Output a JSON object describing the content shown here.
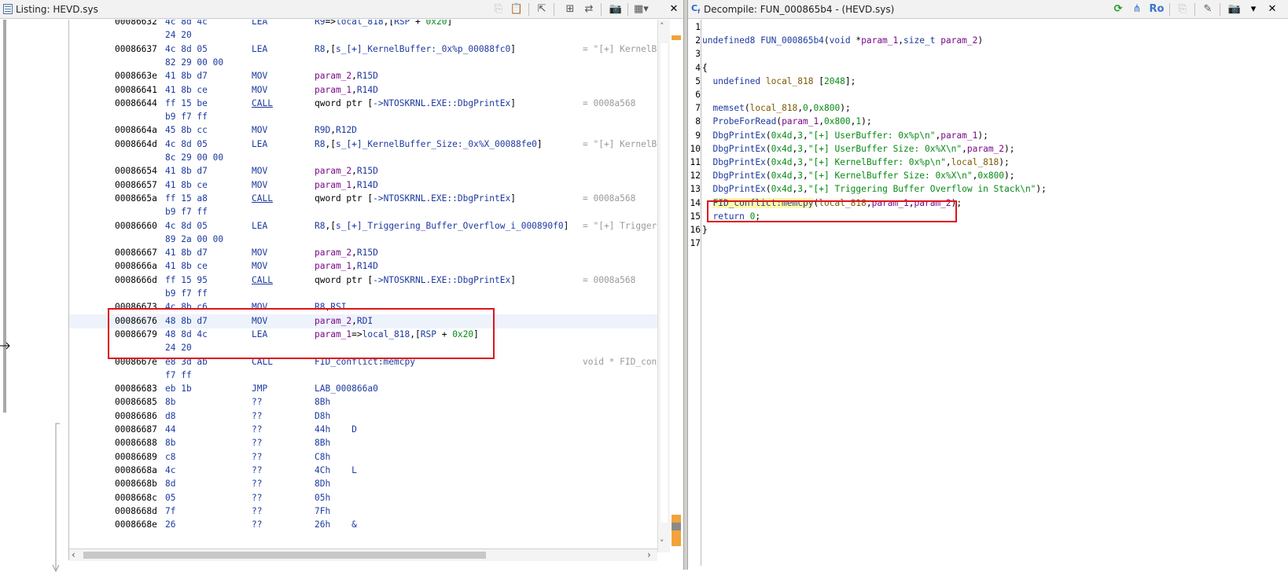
{
  "listing": {
    "title": "Listing:  HEVD.sys",
    "rows": [
      {
        "addr": "00086632",
        "bytes": "4c 8d 4c",
        "mn": "LEA",
        "op": [
          {
            "t": "R9",
            "c": "reg"
          },
          {
            "t": "=>"
          },
          {
            "t": "local_818",
            "c": "lbl"
          },
          {
            "t": ",["
          },
          {
            "t": "RSP",
            "c": "reg"
          },
          {
            "t": " + "
          },
          {
            "t": "0x20",
            "c": "num"
          },
          {
            "t": "]"
          }
        ],
        "cm": ""
      },
      {
        "addr": "",
        "bytes": "24 20",
        "mn": "",
        "op": [],
        "cm": ""
      },
      {
        "addr": "00086637",
        "bytes": "4c 8d 05",
        "mn": "LEA",
        "op": [
          {
            "t": "R8",
            "c": "reg"
          },
          {
            "t": ",["
          },
          {
            "t": "s_[+]_KernelBuffer:_0x%p_00088fc0",
            "c": "lbl"
          },
          {
            "t": "]"
          }
        ],
        "cm": "= \"[+] KernelB"
      },
      {
        "addr": "",
        "bytes": "82 29 00 00",
        "mn": "",
        "op": [],
        "cm": ""
      },
      {
        "addr": "0008663e",
        "bytes": "41 8b d7",
        "mn": "MOV",
        "op": [
          {
            "t": "param_2",
            "c": "par"
          },
          {
            "t": ","
          },
          {
            "t": "R15D",
            "c": "reg"
          }
        ],
        "cm": ""
      },
      {
        "addr": "00086641",
        "bytes": "41 8b ce",
        "mn": "MOV",
        "op": [
          {
            "t": "param_1",
            "c": "par"
          },
          {
            "t": ","
          },
          {
            "t": "R14D",
            "c": "reg"
          }
        ],
        "cm": ""
      },
      {
        "addr": "00086644",
        "bytes": "ff 15 be",
        "mn": "CALL",
        "u": true,
        "op": [
          {
            "t": "qword ptr ["
          },
          {
            "t": "->NTOSKRNL.EXE::DbgPrintEx",
            "c": "lbl"
          },
          {
            "t": "]"
          }
        ],
        "cm": "= 0008a568"
      },
      {
        "addr": "",
        "bytes": "b9 f7 ff",
        "mn": "",
        "op": [],
        "cm": ""
      },
      {
        "addr": "0008664a",
        "bytes": "45 8b cc",
        "mn": "MOV",
        "op": [
          {
            "t": "R9D",
            "c": "reg"
          },
          {
            "t": ","
          },
          {
            "t": "R12D",
            "c": "reg"
          }
        ],
        "cm": ""
      },
      {
        "addr": "0008664d",
        "bytes": "4c 8d 05",
        "mn": "LEA",
        "op": [
          {
            "t": "R8",
            "c": "reg"
          },
          {
            "t": ",["
          },
          {
            "t": "s_[+]_KernelBuffer_Size:_0x%X_00088fe0",
            "c": "lbl"
          },
          {
            "t": "]"
          }
        ],
        "cm": "= \"[+] KernelB"
      },
      {
        "addr": "",
        "bytes": "8c 29 00 00",
        "mn": "",
        "op": [],
        "cm": ""
      },
      {
        "addr": "00086654",
        "bytes": "41 8b d7",
        "mn": "MOV",
        "op": [
          {
            "t": "param_2",
            "c": "par"
          },
          {
            "t": ","
          },
          {
            "t": "R15D",
            "c": "reg"
          }
        ],
        "cm": ""
      },
      {
        "addr": "00086657",
        "bytes": "41 8b ce",
        "mn": "MOV",
        "op": [
          {
            "t": "param_1",
            "c": "par"
          },
          {
            "t": ","
          },
          {
            "t": "R14D",
            "c": "reg"
          }
        ],
        "cm": ""
      },
      {
        "addr": "0008665a",
        "bytes": "ff 15 a8",
        "mn": "CALL",
        "u": true,
        "op": [
          {
            "t": "qword ptr ["
          },
          {
            "t": "->NTOSKRNL.EXE::DbgPrintEx",
            "c": "lbl"
          },
          {
            "t": "]"
          }
        ],
        "cm": "= 0008a568"
      },
      {
        "addr": "",
        "bytes": "b9 f7 ff",
        "mn": "",
        "op": [],
        "cm": ""
      },
      {
        "addr": "00086660",
        "bytes": "4c 8d 05",
        "mn": "LEA",
        "op": [
          {
            "t": "R8",
            "c": "reg"
          },
          {
            "t": ",["
          },
          {
            "t": "s_[+]_Triggering_Buffer_Overflow_i_000890f0",
            "c": "lbl"
          },
          {
            "t": "]"
          }
        ],
        "cm": "= \"[+] Trigger"
      },
      {
        "addr": "",
        "bytes": "89 2a 00 00",
        "mn": "",
        "op": [],
        "cm": ""
      },
      {
        "addr": "00086667",
        "bytes": "41 8b d7",
        "mn": "MOV",
        "op": [
          {
            "t": "param_2",
            "c": "par"
          },
          {
            "t": ","
          },
          {
            "t": "R15D",
            "c": "reg"
          }
        ],
        "cm": ""
      },
      {
        "addr": "0008666a",
        "bytes": "41 8b ce",
        "mn": "MOV",
        "op": [
          {
            "t": "param_1",
            "c": "par"
          },
          {
            "t": ","
          },
          {
            "t": "R14D",
            "c": "reg"
          }
        ],
        "cm": ""
      },
      {
        "addr": "0008666d",
        "bytes": "ff 15 95",
        "mn": "CALL",
        "u": true,
        "op": [
          {
            "t": "qword ptr ["
          },
          {
            "t": "->NTOSKRNL.EXE::DbgPrintEx",
            "c": "lbl"
          },
          {
            "t": "]"
          }
        ],
        "cm": "= 0008a568"
      },
      {
        "addr": "",
        "bytes": "b9 f7 ff",
        "mn": "",
        "op": [],
        "cm": ""
      },
      {
        "addr": "00086673",
        "bytes": "4c 8b c6",
        "mn": "MOV",
        "op": [
          {
            "t": "R8",
            "c": "reg"
          },
          {
            "t": ","
          },
          {
            "t": "RSI",
            "c": "reg"
          }
        ],
        "cm": ""
      },
      {
        "addr": "00086676",
        "bytes": "48 8b d7",
        "mn": "MOV",
        "op": [
          {
            "t": "param_2",
            "c": "par"
          },
          {
            "t": ","
          },
          {
            "t": "RDI",
            "c": "reg"
          }
        ],
        "cm": "",
        "hl": true
      },
      {
        "addr": "00086679",
        "bytes": "48 8d 4c",
        "mn": "LEA",
        "op": [
          {
            "t": "param_1",
            "c": "par"
          },
          {
            "t": "=>"
          },
          {
            "t": "local_818",
            "c": "lbl"
          },
          {
            "t": ",["
          },
          {
            "t": "RSP",
            "c": "reg"
          },
          {
            "t": " + "
          },
          {
            "t": "0x20",
            "c": "num"
          },
          {
            "t": "]"
          }
        ],
        "cm": ""
      },
      {
        "addr": "",
        "bytes": "24 20",
        "mn": "",
        "op": [],
        "cm": ""
      },
      {
        "addr": "0008667e",
        "bytes": "e8 3d ab",
        "mn": "CALL",
        "op": [
          {
            "t": "FID_conflict:memcpy",
            "c": "lbl"
          }
        ],
        "cm": "void * FID_con"
      },
      {
        "addr": "",
        "bytes": "f7 ff",
        "mn": "",
        "op": [],
        "cm": ""
      },
      {
        "addr": "00086683",
        "bytes": "eb 1b",
        "mn": "JMP",
        "op": [
          {
            "t": "LAB_000866a0",
            "c": "lbl"
          }
        ],
        "cm": ""
      },
      {
        "addr": "00086685",
        "bytes": "8b",
        "mn": "??",
        "op": [
          {
            "t": "8Bh",
            "c": "lbl"
          }
        ],
        "cm": ""
      },
      {
        "addr": "00086686",
        "bytes": "d8",
        "mn": "??",
        "op": [
          {
            "t": "D8h",
            "c": "lbl"
          }
        ],
        "cm": ""
      },
      {
        "addr": "00086687",
        "bytes": "44",
        "mn": "??",
        "op": [
          {
            "t": "44h    D",
            "c": "lbl"
          }
        ],
        "cm": ""
      },
      {
        "addr": "00086688",
        "bytes": "8b",
        "mn": "??",
        "op": [
          {
            "t": "8Bh",
            "c": "lbl"
          }
        ],
        "cm": ""
      },
      {
        "addr": "00086689",
        "bytes": "c8",
        "mn": "??",
        "op": [
          {
            "t": "C8h",
            "c": "lbl"
          }
        ],
        "cm": ""
      },
      {
        "addr": "0008668a",
        "bytes": "4c",
        "mn": "??",
        "op": [
          {
            "t": "4Ch    L",
            "c": "lbl"
          }
        ],
        "cm": ""
      },
      {
        "addr": "0008668b",
        "bytes": "8d",
        "mn": "??",
        "op": [
          {
            "t": "8Dh",
            "c": "lbl"
          }
        ],
        "cm": ""
      },
      {
        "addr": "0008668c",
        "bytes": "05",
        "mn": "??",
        "op": [
          {
            "t": "05h",
            "c": "lbl"
          }
        ],
        "cm": ""
      },
      {
        "addr": "0008668d",
        "bytes": "7f",
        "mn": "??",
        "op": [
          {
            "t": "7Fh",
            "c": "lbl"
          }
        ],
        "cm": ""
      },
      {
        "addr": "0008668e",
        "bytes": "26",
        "mn": "??",
        "op": [
          {
            "t": "26h    &",
            "c": "lbl"
          }
        ],
        "cm": ""
      }
    ]
  },
  "decompile": {
    "title": "Decompile: FUN_000865b4 -  (HEVD.sys)",
    "ro_label": "Ro",
    "lines": [
      {
        "n": "1",
        "parts": []
      },
      {
        "n": "2",
        "parts": [
          {
            "t": "undefined8 ",
            "c": "type"
          },
          {
            "t": "FUN_000865b4",
            "c": "fn"
          },
          {
            "t": "("
          },
          {
            "t": "void",
            "c": "type"
          },
          {
            "t": " *"
          },
          {
            "t": "param_1",
            "c": "par"
          },
          {
            "t": ","
          },
          {
            "t": "size_t",
            "c": "type"
          },
          {
            "t": " "
          },
          {
            "t": "param_2",
            "c": "par"
          },
          {
            "t": ")"
          }
        ]
      },
      {
        "n": "3",
        "parts": []
      },
      {
        "n": "4",
        "parts": [
          {
            "t": "{"
          }
        ]
      },
      {
        "n": "5",
        "parts": [
          {
            "t": "  "
          },
          {
            "t": "undefined",
            "c": "type"
          },
          {
            "t": " "
          },
          {
            "t": "local_818",
            "c": "var"
          },
          {
            "t": " ["
          },
          {
            "t": "2048",
            "c": "num"
          },
          {
            "t": "];"
          }
        ]
      },
      {
        "n": "6",
        "parts": []
      },
      {
        "n": "7",
        "parts": [
          {
            "t": "  "
          },
          {
            "t": "memset",
            "c": "fn"
          },
          {
            "t": "("
          },
          {
            "t": "local_818",
            "c": "var"
          },
          {
            "t": ","
          },
          {
            "t": "0",
            "c": "num"
          },
          {
            "t": ","
          },
          {
            "t": "0x800",
            "c": "num"
          },
          {
            "t": ");"
          }
        ]
      },
      {
        "n": "8",
        "parts": [
          {
            "t": "  "
          },
          {
            "t": "ProbeForRead",
            "c": "fn"
          },
          {
            "t": "("
          },
          {
            "t": "param_1",
            "c": "par"
          },
          {
            "t": ","
          },
          {
            "t": "0x800",
            "c": "num"
          },
          {
            "t": ","
          },
          {
            "t": "1",
            "c": "num"
          },
          {
            "t": ");"
          }
        ]
      },
      {
        "n": "9",
        "parts": [
          {
            "t": "  "
          },
          {
            "t": "DbgPrintEx",
            "c": "fn"
          },
          {
            "t": "("
          },
          {
            "t": "0x4d",
            "c": "num"
          },
          {
            "t": ","
          },
          {
            "t": "3",
            "c": "num"
          },
          {
            "t": ","
          },
          {
            "t": "\"[+] UserBuffer: 0x%p\\n\"",
            "c": "str"
          },
          {
            "t": ","
          },
          {
            "t": "param_1",
            "c": "par"
          },
          {
            "t": ");"
          }
        ]
      },
      {
        "n": "10",
        "parts": [
          {
            "t": "  "
          },
          {
            "t": "DbgPrintEx",
            "c": "fn"
          },
          {
            "t": "("
          },
          {
            "t": "0x4d",
            "c": "num"
          },
          {
            "t": ","
          },
          {
            "t": "3",
            "c": "num"
          },
          {
            "t": ","
          },
          {
            "t": "\"[+] UserBuffer Size: 0x%X\\n\"",
            "c": "str"
          },
          {
            "t": ","
          },
          {
            "t": "param_2",
            "c": "par"
          },
          {
            "t": ");"
          }
        ]
      },
      {
        "n": "11",
        "parts": [
          {
            "t": "  "
          },
          {
            "t": "DbgPrintEx",
            "c": "fn"
          },
          {
            "t": "("
          },
          {
            "t": "0x4d",
            "c": "num"
          },
          {
            "t": ","
          },
          {
            "t": "3",
            "c": "num"
          },
          {
            "t": ","
          },
          {
            "t": "\"[+] KernelBuffer: 0x%p\\n\"",
            "c": "str"
          },
          {
            "t": ","
          },
          {
            "t": "local_818",
            "c": "var"
          },
          {
            "t": ");"
          }
        ]
      },
      {
        "n": "12",
        "parts": [
          {
            "t": "  "
          },
          {
            "t": "DbgPrintEx",
            "c": "fn"
          },
          {
            "t": "("
          },
          {
            "t": "0x4d",
            "c": "num"
          },
          {
            "t": ","
          },
          {
            "t": "3",
            "c": "num"
          },
          {
            "t": ","
          },
          {
            "t": "\"[+] KernelBuffer Size: 0x%X\\n\"",
            "c": "str"
          },
          {
            "t": ","
          },
          {
            "t": "0x800",
            "c": "num"
          },
          {
            "t": ");"
          }
        ]
      },
      {
        "n": "13",
        "parts": [
          {
            "t": "  "
          },
          {
            "t": "DbgPrintEx",
            "c": "fn"
          },
          {
            "t": "("
          },
          {
            "t": "0x4d",
            "c": "num"
          },
          {
            "t": ","
          },
          {
            "t": "3",
            "c": "num"
          },
          {
            "t": ","
          },
          {
            "t": "\"[+] Triggering Buffer Overflow in Stack\\n\"",
            "c": "str"
          },
          {
            "t": ");"
          }
        ]
      },
      {
        "n": "14",
        "parts": [
          {
            "t": "  "
          },
          {
            "t": "FID_conflict:memcpy",
            "c": "fn",
            "hl": true
          },
          {
            "t": "("
          },
          {
            "t": "local_818",
            "c": "var"
          },
          {
            "t": ","
          },
          {
            "t": "param_1",
            "c": "par"
          },
          {
            "t": ","
          },
          {
            "t": "param_2",
            "c": "par"
          },
          {
            "t": ");"
          }
        ]
      },
      {
        "n": "15",
        "parts": [
          {
            "t": "  "
          },
          {
            "t": "return",
            "c": "kw"
          },
          {
            "t": " "
          },
          {
            "t": "0",
            "c": "num"
          },
          {
            "t": ";"
          }
        ]
      },
      {
        "n": "16",
        "parts": [
          {
            "t": "}"
          }
        ]
      },
      {
        "n": "17",
        "parts": []
      }
    ]
  },
  "colors": {
    "highlight_box": "#e0131b",
    "selected_row": "#eef3fb",
    "token_highlight": "#fff9a8"
  }
}
